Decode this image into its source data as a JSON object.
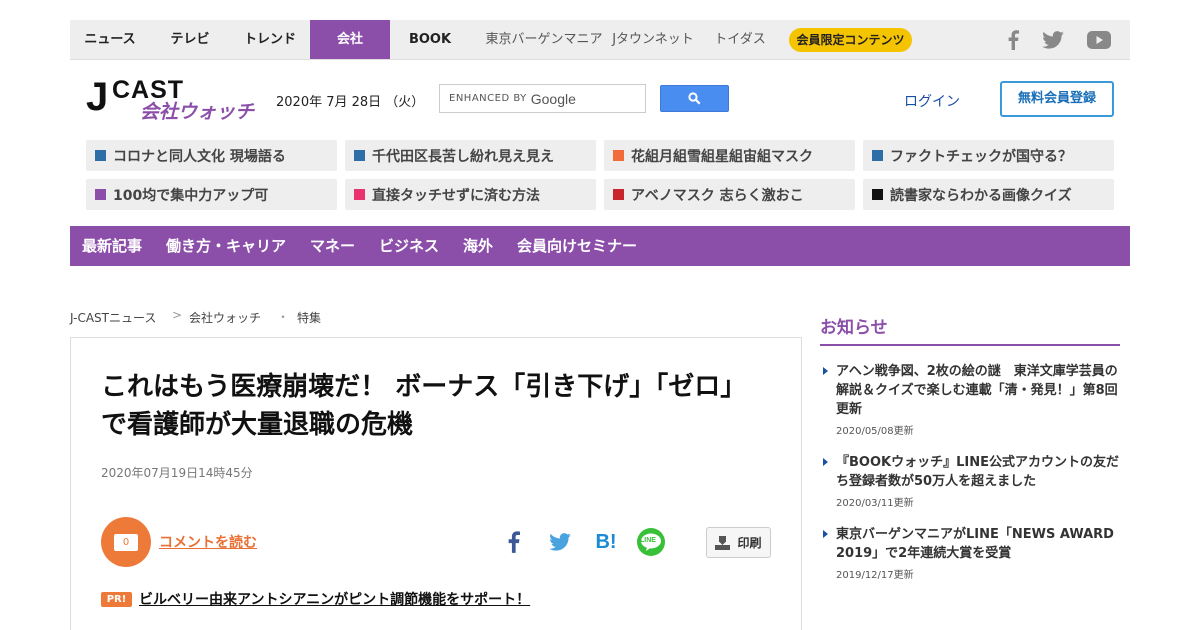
{
  "topnav": {
    "items": [
      {
        "label": "ニュース"
      },
      {
        "label": "テレビ"
      },
      {
        "label": "トレンド"
      },
      {
        "label": "会社"
      },
      {
        "label": "BOOK"
      },
      {
        "label": "東京バーゲンマニア"
      },
      {
        "label": "Jタウンネット"
      },
      {
        "label": "トイダス"
      }
    ],
    "badge": "会員限定コンテンツ",
    "social_icons": [
      "facebook-icon",
      "twitter-icon",
      "youtube-icon"
    ]
  },
  "header": {
    "logo_main": "CAST",
    "logo_j": "J",
    "logo_sub": "会社ウォッチ",
    "date": "2020年 7月 28日 （火）",
    "search_label": "ENHANCED BY",
    "search_brand": "Google",
    "login": "ログイン",
    "register": "無料会員登録"
  },
  "tags": [
    {
      "label": "コロナと同人文化 現場語る",
      "color": "#2d6ea6"
    },
    {
      "label": "千代田区長苦し紛れ見え見え",
      "color": "#2d6ea6"
    },
    {
      "label": "花組月組雪組星組宙組マスク",
      "color": "#f26b3a"
    },
    {
      "label": "ファクトチェックが国守る？",
      "color": "#2d6ea6"
    },
    {
      "label": "100均で集中力アップ可",
      "color": "#8b4faa"
    },
    {
      "label": "直接タッチせずに済む方法",
      "color": "#e8336e"
    },
    {
      "label": "アベノマスク 志らく激おこ",
      "color": "#c8262c"
    },
    {
      "label": "読書家ならわかる画像クイズ",
      "color": "#111111"
    }
  ],
  "categories": [
    {
      "label": "最新記事"
    },
    {
      "label": "働き方・キャリア"
    },
    {
      "label": "マネー"
    },
    {
      "label": "ビジネス"
    },
    {
      "label": "海外"
    },
    {
      "label": "会員向けセミナー"
    }
  ],
  "breadcrumb": {
    "items": [
      "J-CASTニュース",
      "会社ウォッチ",
      "特集"
    ],
    "separators": [
      ">",
      "・"
    ]
  },
  "article": {
    "headline": "これはもう医療崩壊だ！ ボーナス「引き下げ」「ゼロ」で看護師が大量退職の危機",
    "date": "2020年07月19日14時45分",
    "comment_count": "0",
    "comment_link": "コメントを読む",
    "share_icons": [
      "facebook-icon",
      "twitter-icon",
      "hatena-bookmark-icon",
      "line-icon"
    ],
    "hatena_label": "B!",
    "line_label": "LINE",
    "print": "印刷",
    "pr_badge": "PR!",
    "pr_link": "ビルベリー由来アントシアニンがピント調節機能をサポート！"
  },
  "sidebar": {
    "title": "お知らせ",
    "items": [
      {
        "title": "アヘン戦争図、2枚の絵の謎　東洋文庫学芸員の解説＆クイズで楽しむ連載「清・発見！」第8回更新",
        "date": "2020/05/08更新"
      },
      {
        "title": "『BOOKウォッチ』LINE公式アカウントの友だち登録者数が50万人を超えました",
        "date": "2020/03/11更新"
      },
      {
        "title": "東京バーゲンマニアがLINE「NEWS AWARD 2019」で2年連続大賞を受賞",
        "date": "2019/12/17更新"
      }
    ]
  },
  "colors": {
    "brand_purple": "#8b4faa",
    "accent_orange": "#ee7a3a",
    "badge_yellow": "#f5c400",
    "search_blue": "#4a8df0"
  }
}
